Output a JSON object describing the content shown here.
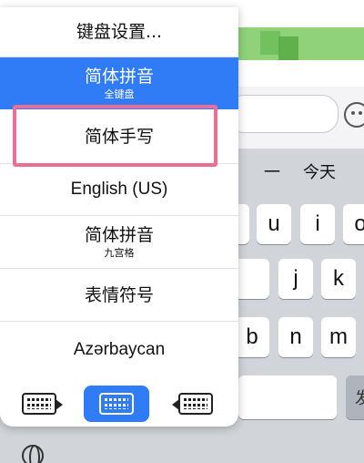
{
  "keyboard_menu": {
    "settings_label": "键盘设置...",
    "items": [
      {
        "label": "简体拼音",
        "sublabel": "全键盘",
        "selected": true
      },
      {
        "label": "简体手写",
        "sublabel": "",
        "selected": false,
        "highlighted": true
      },
      {
        "label": "English (US)",
        "sublabel": "",
        "selected": false
      },
      {
        "label": "简体拼音",
        "sublabel": "九宫格",
        "selected": false
      },
      {
        "label": "表情符号",
        "sublabel": "",
        "selected": false
      },
      {
        "label": "Azərbaycan",
        "sublabel": "",
        "selected": false
      }
    ],
    "switcher": {
      "left_icon": "keyboard-left-icon",
      "center_icon": "keyboard-full-icon",
      "right_icon": "keyboard-right-icon"
    }
  },
  "candidates": [
    "一",
    "今天"
  ],
  "keys": {
    "row1": [
      "u",
      "i",
      "o"
    ],
    "row2": [
      "j",
      "k"
    ],
    "row3": [
      "b",
      "n",
      "m"
    ],
    "grey_partial": "发"
  },
  "icons": {
    "emoji": "emoji-icon",
    "globe": "globe-icon"
  },
  "colors": {
    "accent": "#2f7cf6",
    "highlight_border": "#ee6d90",
    "keyboard_bg": "#d1d4d9",
    "chat_green": "#8fd27a"
  }
}
